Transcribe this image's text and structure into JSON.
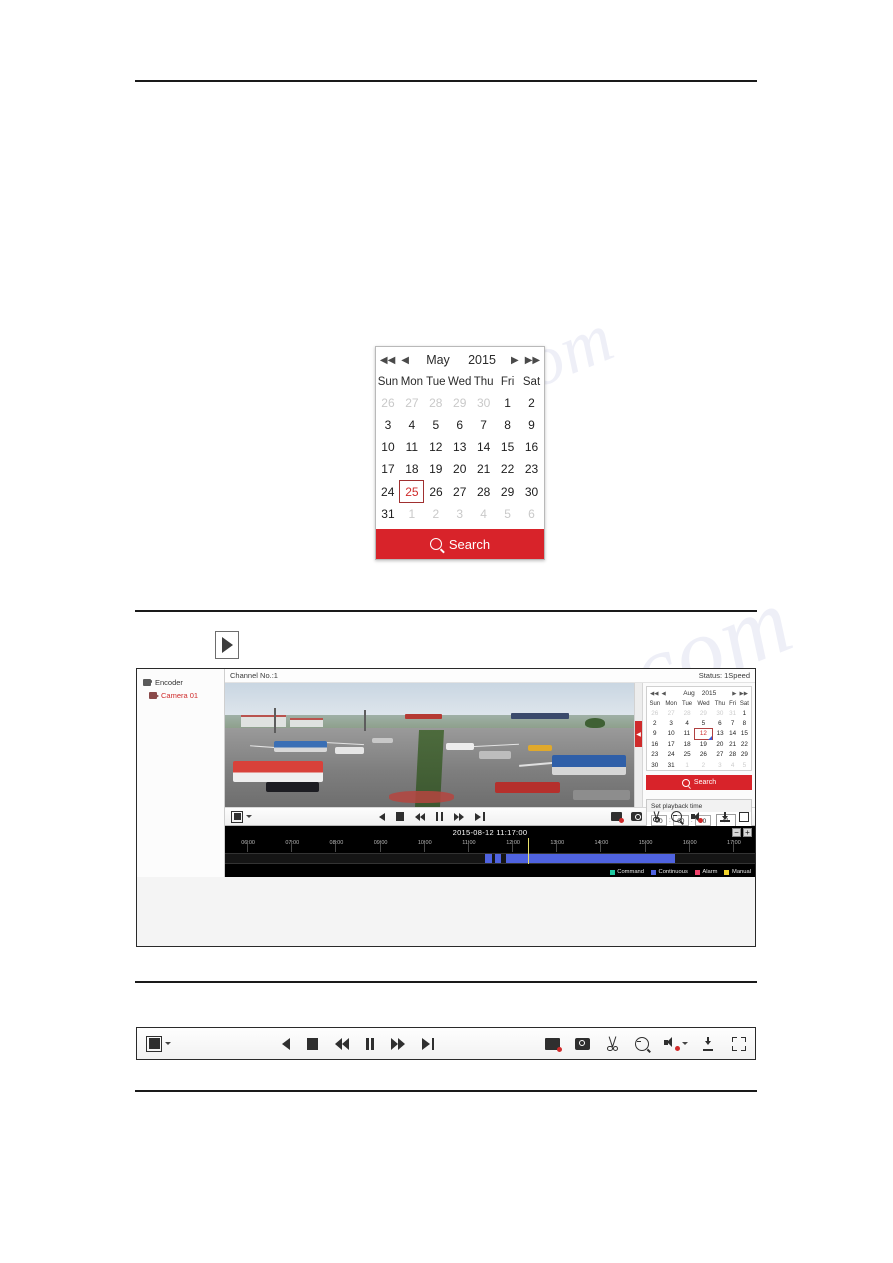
{
  "watermark": {
    "line1": "manualshive.com",
    "line2": "ls.com"
  },
  "calendar_large": {
    "month": "May",
    "year": "2015",
    "nav": {
      "first": "◀◀",
      "prev": "◀",
      "next": "▶",
      "last": "▶▶"
    },
    "weekdays": [
      "Sun",
      "Mon",
      "Tue",
      "Wed",
      "Thu",
      "Fri",
      "Sat"
    ],
    "weeks": [
      [
        {
          "d": "26",
          "o": true
        },
        {
          "d": "27",
          "o": true
        },
        {
          "d": "28",
          "o": true
        },
        {
          "d": "29",
          "o": true
        },
        {
          "d": "30",
          "o": true
        },
        {
          "d": "1"
        },
        {
          "d": "2"
        }
      ],
      [
        {
          "d": "3"
        },
        {
          "d": "4"
        },
        {
          "d": "5"
        },
        {
          "d": "6"
        },
        {
          "d": "7"
        },
        {
          "d": "8"
        },
        {
          "d": "9"
        }
      ],
      [
        {
          "d": "10"
        },
        {
          "d": "11"
        },
        {
          "d": "12"
        },
        {
          "d": "13"
        },
        {
          "d": "14"
        },
        {
          "d": "15"
        },
        {
          "d": "16"
        }
      ],
      [
        {
          "d": "17"
        },
        {
          "d": "18"
        },
        {
          "d": "19"
        },
        {
          "d": "20"
        },
        {
          "d": "21"
        },
        {
          "d": "22"
        },
        {
          "d": "23"
        }
      ],
      [
        {
          "d": "24"
        },
        {
          "d": "25",
          "sel": true
        },
        {
          "d": "26"
        },
        {
          "d": "27"
        },
        {
          "d": "28"
        },
        {
          "d": "29"
        },
        {
          "d": "30"
        }
      ],
      [
        {
          "d": "31"
        },
        {
          "d": "1",
          "o": true
        },
        {
          "d": "2",
          "o": true
        },
        {
          "d": "3",
          "o": true
        },
        {
          "d": "4",
          "o": true
        },
        {
          "d": "5",
          "o": true
        },
        {
          "d": "6",
          "o": true
        }
      ]
    ],
    "search_label": "Search",
    "selected_day": "25",
    "accent_color": "#d8232a"
  },
  "playback": {
    "tree": {
      "encoder_label": "Encoder",
      "camera_label": "Camera 01"
    },
    "status": {
      "channel": "Channel No.:1",
      "speed": "Status: 1Speed"
    },
    "calendar_small": {
      "month": "Aug",
      "year": "2015",
      "nav": {
        "first": "◀◀",
        "prev": "◀",
        "next": "▶",
        "last": "▶▶"
      },
      "weekdays": [
        "Sun",
        "Mon",
        "Tue",
        "Wed",
        "Thu",
        "Fri",
        "Sat"
      ],
      "weeks": [
        [
          {
            "d": "26",
            "o": true
          },
          {
            "d": "27",
            "o": true
          },
          {
            "d": "28",
            "o": true
          },
          {
            "d": "29",
            "o": true
          },
          {
            "d": "30",
            "o": true
          },
          {
            "d": "31",
            "o": true
          },
          {
            "d": "1"
          }
        ],
        [
          {
            "d": "2"
          },
          {
            "d": "3"
          },
          {
            "d": "4"
          },
          {
            "d": "5"
          },
          {
            "d": "6"
          },
          {
            "d": "7"
          },
          {
            "d": "8"
          }
        ],
        [
          {
            "d": "9"
          },
          {
            "d": "10"
          },
          {
            "d": "11"
          },
          {
            "d": "12",
            "sel": true
          },
          {
            "d": "13"
          },
          {
            "d": "14"
          },
          {
            "d": "15"
          }
        ],
        [
          {
            "d": "16"
          },
          {
            "d": "17"
          },
          {
            "d": "18"
          },
          {
            "d": "19"
          },
          {
            "d": "20"
          },
          {
            "d": "21"
          },
          {
            "d": "22"
          }
        ],
        [
          {
            "d": "23"
          },
          {
            "d": "24"
          },
          {
            "d": "25"
          },
          {
            "d": "26"
          },
          {
            "d": "27"
          },
          {
            "d": "28"
          },
          {
            "d": "29"
          }
        ],
        [
          {
            "d": "30"
          },
          {
            "d": "31"
          },
          {
            "d": "1",
            "o": true
          },
          {
            "d": "2",
            "o": true
          },
          {
            "d": "3",
            "o": true
          },
          {
            "d": "4",
            "o": true
          },
          {
            "d": "5",
            "o": true
          }
        ]
      ],
      "search_label": "Search",
      "selected_day": "12"
    },
    "set_playback_time": {
      "caption": "Set playback time",
      "hour": "00",
      "minute": "00",
      "second": "00",
      "separator": ":",
      "enter_glyph": "↵"
    },
    "toolbar": {
      "layout_label": "layout-select",
      "reverse_play": "reverse-play",
      "stop": "stop",
      "rewind": "rewind",
      "pause": "pause",
      "fast_forward": "fast-forward",
      "single_frame": "single-frame",
      "record": "record",
      "capture": "capture",
      "clip": "clip",
      "digital_zoom": "digital-zoom",
      "audio": "audio",
      "download": "download",
      "fullscreen": "full-screen"
    },
    "splitter_glyph": "◀"
  },
  "timeline": {
    "current_time": "2015-08-12 11:17:00",
    "zoom_out": "−",
    "zoom_in": "+",
    "hour_labels": [
      "06:00",
      "07:00",
      "08:00",
      "09:00",
      "10:00",
      "11:00",
      "12:00",
      "13:00",
      "14:00",
      "15:00",
      "16:00",
      "17:00"
    ],
    "legend": [
      {
        "label": "Command",
        "color": "#1ec8a0"
      },
      {
        "label": "Continuous",
        "color": "#4f63e0"
      },
      {
        "label": "Alarm",
        "color": "#f0406a"
      },
      {
        "label": "Manual",
        "color": "#f2d32a"
      }
    ],
    "segments": [
      {
        "start_pct": 49.0,
        "end_pct": 50.4,
        "color": "#4f63e0"
      },
      {
        "start_pct": 51.0,
        "end_pct": 52.0,
        "color": "#4f63e0"
      },
      {
        "start_pct": 53.0,
        "end_pct": 85.0,
        "color": "#4f63e0"
      }
    ],
    "cursor_pct": 57.2
  },
  "bottom_toolbar": {
    "layout_label": "layout-select",
    "reverse_play": "reverse-play",
    "stop": "stop",
    "rewind": "rewind",
    "pause": "pause",
    "fast_forward": "fast-forward",
    "single_frame": "single-frame",
    "record": "record",
    "capture": "capture",
    "clip": "clip",
    "digital_zoom": "digital-zoom",
    "audio": "audio",
    "download": "download",
    "fullscreen": "full-screen"
  }
}
